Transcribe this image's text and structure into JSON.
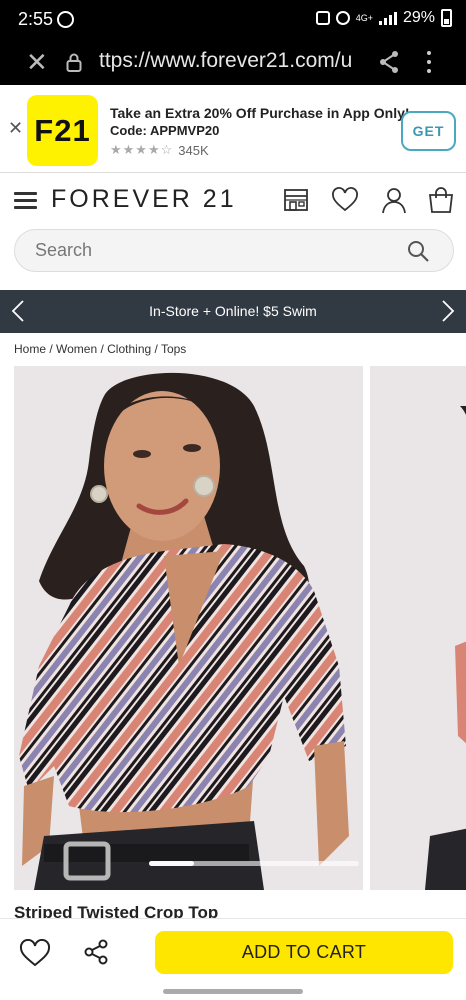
{
  "status_bar": {
    "time": "2:55",
    "network": "4G+",
    "battery": "29%"
  },
  "browser": {
    "url": "ttps://www.forever21.com/u"
  },
  "app_banner": {
    "logo": "F21",
    "title": "Take an Extra 20% Off Purchase in App Only!",
    "code": "Code: APPMVP20",
    "stars": "★★★★☆",
    "rating_count": "345K",
    "get_label": "GET"
  },
  "header": {
    "logo": "FOREVER 21"
  },
  "search": {
    "placeholder": "Search"
  },
  "promo": {
    "text": "In-Store + Online! $5 Swim"
  },
  "breadcrumb": "Home / Women / Clothing / Tops",
  "product": {
    "title": "Striped Twisted Crop Top",
    "gallery_position": 0.19
  },
  "actions": {
    "add_to_cart": "ADD TO CART"
  },
  "colors": {
    "brand_yellow": "#ffe601",
    "promo_bg": "#313943",
    "get_accent": "#4aa9c1"
  }
}
